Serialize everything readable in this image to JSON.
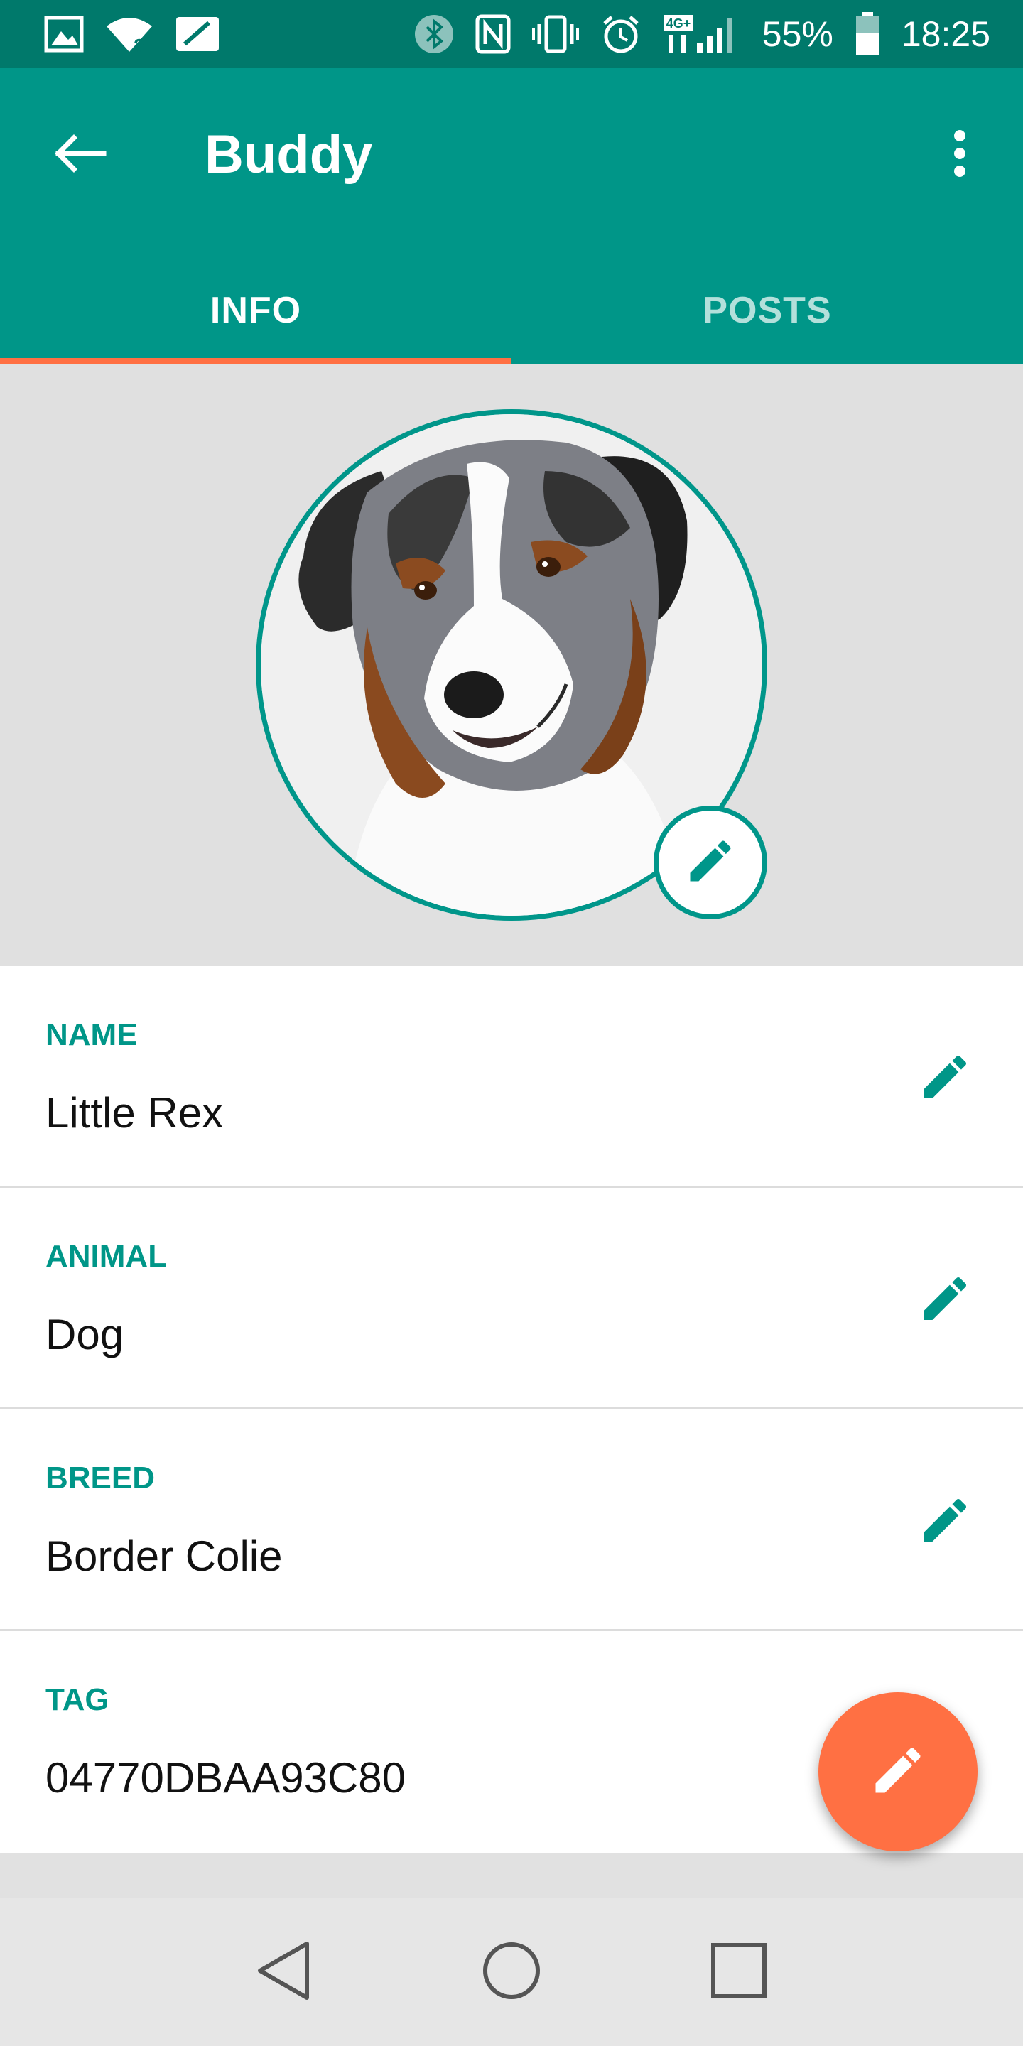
{
  "status_bar": {
    "battery_percent": "55%",
    "time": "18:25",
    "network_badge": "4G+",
    "icons_left": [
      "image-icon",
      "wifi-icon",
      "sim-icon"
    ],
    "icons_right": [
      "bluetooth-icon",
      "nfc-icon",
      "vibrate-icon",
      "alarm-icon",
      "signal-icon",
      "battery-icon"
    ]
  },
  "app_bar": {
    "title": "Buddy",
    "tabs": [
      {
        "label": "INFO",
        "active": true
      },
      {
        "label": "POSTS",
        "active": false
      }
    ]
  },
  "profile": {
    "avatar": "dog-photo"
  },
  "fields": [
    {
      "label": "NAME",
      "value": "Little Rex"
    },
    {
      "label": "ANIMAL",
      "value": "Dog"
    },
    {
      "label": "BREED",
      "value": "Border Colie"
    },
    {
      "label": "TAG",
      "value": "04770DBAA93C80"
    }
  ],
  "colors": {
    "primary": "#009688",
    "primary_dark": "#00796b",
    "accent": "#ff7043"
  }
}
